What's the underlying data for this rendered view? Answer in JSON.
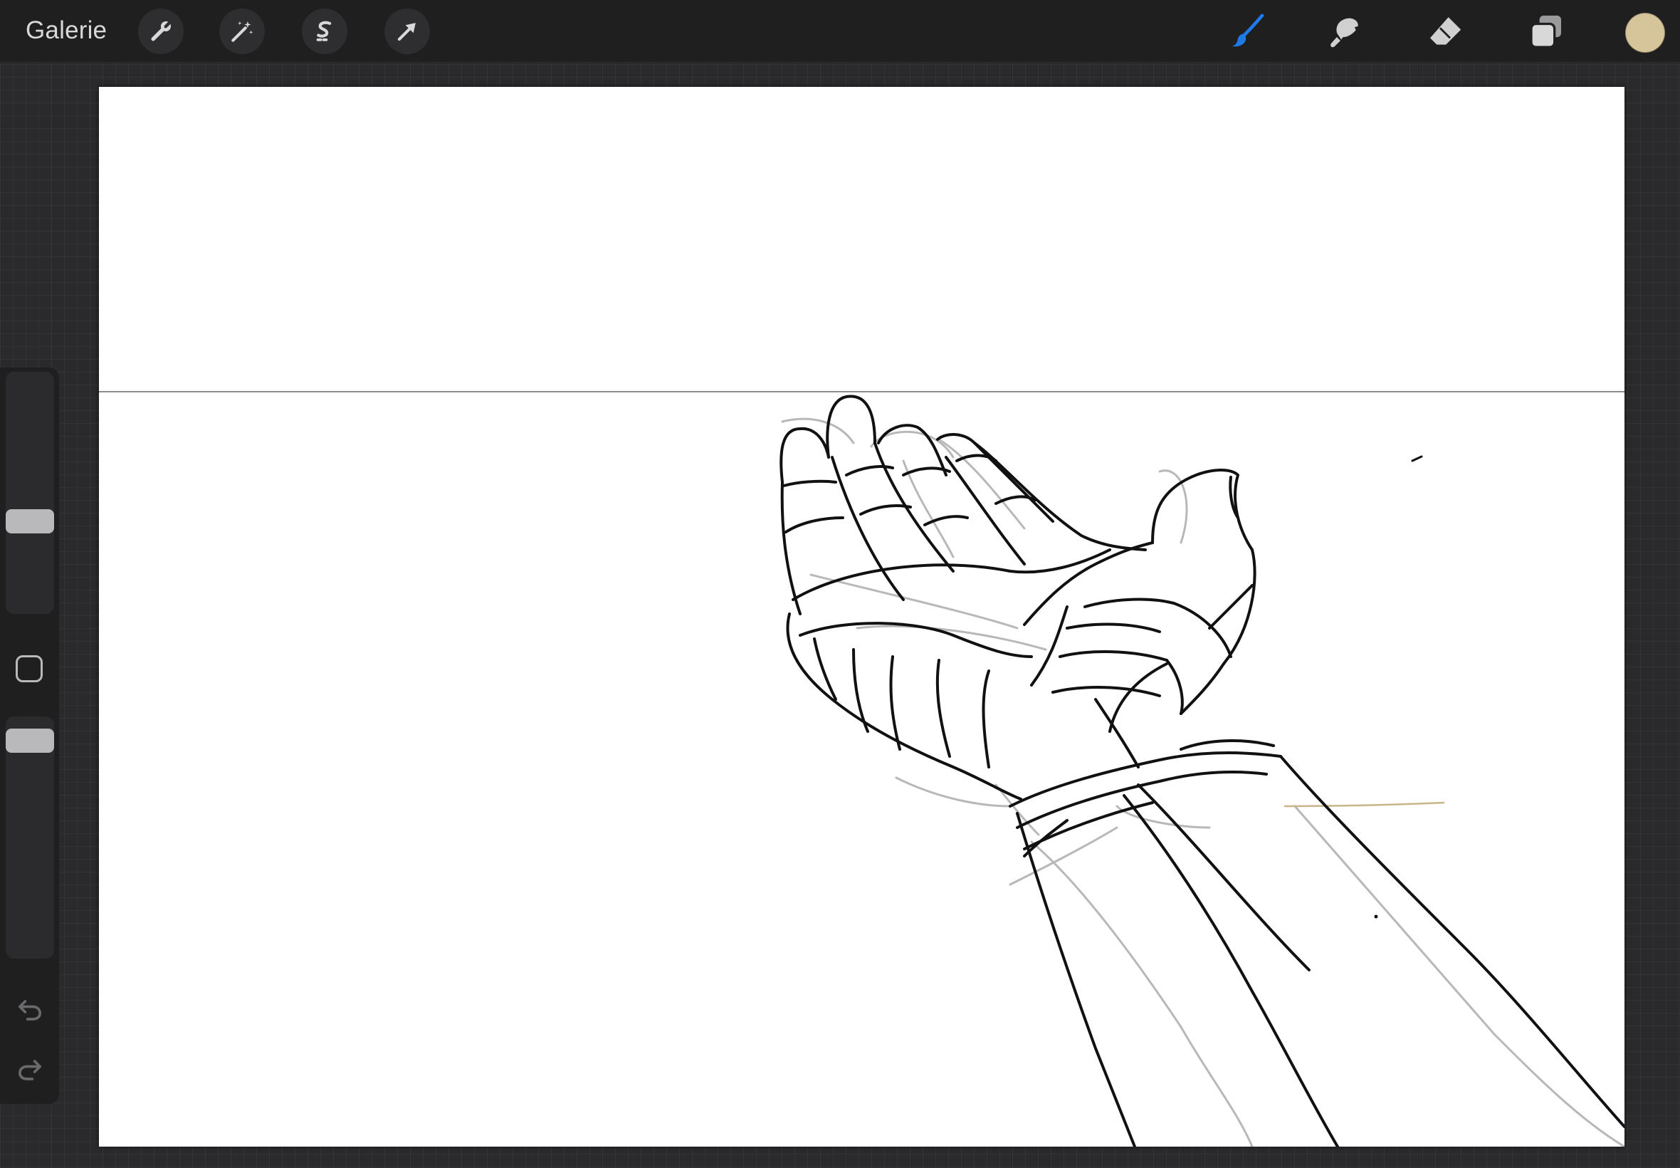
{
  "app": {
    "gallery_label": "Galerie"
  },
  "toolbar_left": {
    "icons": [
      "wrench-icon",
      "magic-wand-icon",
      "selection-icon",
      "transform-arrow-icon"
    ]
  },
  "toolbar_right": {
    "icons": [
      "brush-icon",
      "smudge-icon",
      "eraser-icon",
      "layers-icon"
    ],
    "active_tool": "brush",
    "active_color": "#d6c49a",
    "brush_active_color": "#1f7ae8"
  },
  "sidebar": {
    "brush_size_fraction": 0.58,
    "opacity_fraction": 0.96,
    "icons": [
      "modify-square-icon",
      "undo-icon",
      "redo-icon"
    ]
  },
  "canvas": {
    "background": "#ffffff",
    "drawing": "hand-sketch"
  }
}
